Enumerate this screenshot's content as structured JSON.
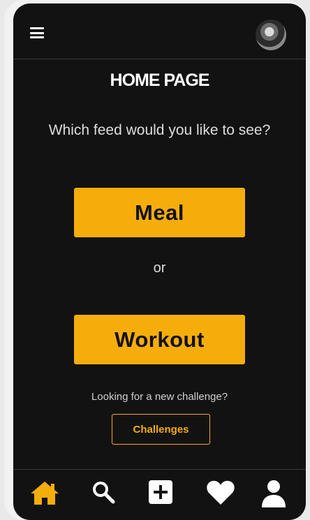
{
  "header": {
    "menu_icon": "hamburger-menu-icon",
    "avatar": "profile-avatar"
  },
  "main": {
    "title": "HOME PAGE",
    "question": "Which feed would you like to see?",
    "meal_label": "Meal",
    "or_text": "or",
    "workout_label": "Workout",
    "challenge_prompt": "Looking for a new challenge?",
    "challenges_label": "Challenges"
  },
  "bottom_nav": {
    "items": [
      {
        "icon": "home-icon",
        "active": true
      },
      {
        "icon": "search-icon",
        "active": false
      },
      {
        "icon": "add-post-icon",
        "active": false
      },
      {
        "icon": "heart-icon",
        "active": false
      },
      {
        "icon": "profile-icon",
        "active": false
      }
    ]
  },
  "colors": {
    "accent": "#f5ad0c",
    "background": "#121212",
    "text": "#ffffff"
  }
}
